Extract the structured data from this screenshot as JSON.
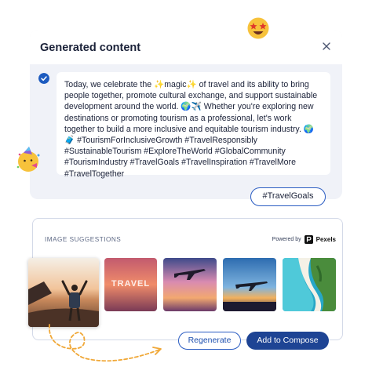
{
  "dialog": {
    "title": "Generated content",
    "body": "Today, we celebrate the ✨magic✨ of travel and its ability to bring people together, promote cultural exchange, and support sustainable development around the world. 🌍✈️ Whether you're exploring new destinations or promoting tourism as a professional, let's work together to build a more inclusive and equitable tourism industry. 🌍🧳 #TourismForInclusiveGrowth #TravelResponsibly #SustainableTourism #ExploreTheWorld #GlobalCommunity #TourismIndustry #TravelGoals #TravelInspiration #TravelMore #TravelTogether",
    "hashtag_chip": "#TravelGoals"
  },
  "suggestions": {
    "label": "IMAGE SUGGESTIONS",
    "powered_by": "Powered by",
    "provider": "Pexels",
    "images": [
      {
        "name": "traveler-at-sunset-beach",
        "text": ""
      },
      {
        "name": "travel-sunset-photo",
        "text": "TRAVEL"
      },
      {
        "name": "airplane-pink-sky",
        "text": ""
      },
      {
        "name": "airplane-over-city-sunset",
        "text": ""
      },
      {
        "name": "tropical-beach-aerial",
        "text": ""
      }
    ],
    "regenerate_label": "Regenerate",
    "add_label": "Add to Compose"
  },
  "icons": [
    "close-icon",
    "check-icon",
    "star-struck-emoji-icon",
    "partying-face-emoji-icon",
    "pexels-logo-icon",
    "dashed-arrow-icon"
  ],
  "colors": {
    "primary": "#1e4494",
    "chip_border": "#2a5cc2",
    "panel_bg": "#f0f2f8"
  }
}
